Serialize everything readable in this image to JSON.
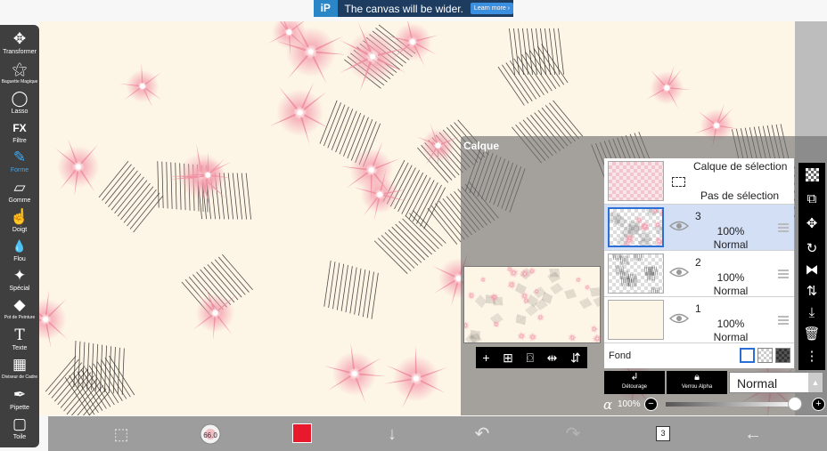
{
  "ad": {
    "logo": "iP",
    "text": "The canvas will be wider.",
    "button": "Learn more ›"
  },
  "tools": [
    {
      "id": "transform",
      "label": "Transformer",
      "icon": "✥"
    },
    {
      "id": "magic-wand",
      "label": "Baguette Magique",
      "icon": "⚝"
    },
    {
      "id": "lasso",
      "label": "Lasso",
      "icon": "◯"
    },
    {
      "id": "filter",
      "label": "Filtre",
      "icon": "FX"
    },
    {
      "id": "brush",
      "label": "Forme",
      "icon": "✎"
    },
    {
      "id": "eraser",
      "label": "Gomme",
      "icon": "▱"
    },
    {
      "id": "smudge",
      "label": "Doigt",
      "icon": "☝"
    },
    {
      "id": "blur",
      "label": "Flou",
      "icon": "💧"
    },
    {
      "id": "special",
      "label": "Spécial",
      "icon": "✦"
    },
    {
      "id": "bucket",
      "label": "Pot de Peinture",
      "icon": "◆"
    },
    {
      "id": "text",
      "label": "Texte",
      "icon": "T"
    },
    {
      "id": "frame-divider",
      "label": "Diviseur de Cadre",
      "icon": "▦"
    },
    {
      "id": "eyedropper",
      "label": "Pipette",
      "icon": "✒"
    },
    {
      "id": "canvas",
      "label": "Toile",
      "icon": "▢"
    }
  ],
  "bottombar": {
    "brush_size": "66.0",
    "brush_color": "#e8192c",
    "layer_count": "3"
  },
  "panel": {
    "title": "Calque",
    "selection_layer": {
      "title": "Calque de sélection",
      "status": "Pas de sélection"
    },
    "layers": [
      {
        "number": "3",
        "opacity": "100%",
        "blend": "Normal"
      },
      {
        "number": "2",
        "opacity": "100%",
        "blend": "Normal"
      },
      {
        "number": "1",
        "opacity": "100%",
        "blend": "Normal"
      }
    ],
    "background_label": "Fond",
    "clipping_label": "Détourage",
    "alpha_lock_label": "Verrou Alpha",
    "blend_mode": "Normal",
    "alpha_symbol": "α",
    "alpha_value": "100%"
  }
}
